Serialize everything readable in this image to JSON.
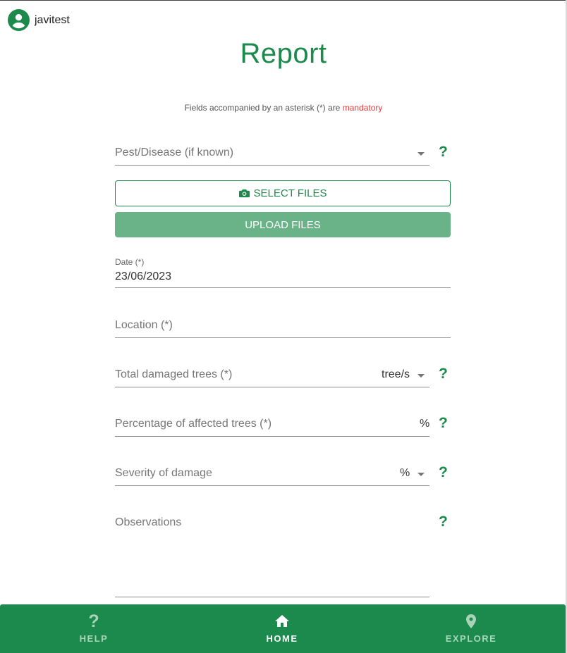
{
  "user": {
    "name": "javitest"
  },
  "page": {
    "title": "Report"
  },
  "note": {
    "prefix": "Fields accompanied by an asterisk (*) are ",
    "mandatory": "mandatory"
  },
  "form": {
    "pest": {
      "placeholder": "Pest/Disease (if known)"
    },
    "select_files": "SELECT FILES",
    "upload_files": "UPLOAD FILES",
    "date": {
      "label": "Date (*)",
      "value": "23/06/2023"
    },
    "location": {
      "placeholder": "Location (*)"
    },
    "damaged": {
      "placeholder": "Total damaged trees (*)",
      "unit": "tree/s"
    },
    "percentage": {
      "placeholder": "Percentage of affected trees (*)",
      "unit": "%"
    },
    "severity": {
      "placeholder": "Severity of damage",
      "unit": "%"
    },
    "observations": {
      "placeholder": "Observations"
    },
    "help_symbol": "?"
  },
  "nav": {
    "help": "HELP",
    "home": "HOME",
    "explore": "EXPLORE",
    "help_icon_glyph": "?"
  },
  "colors": {
    "primary": "#1b8a4c",
    "upload_button": "#6ab287",
    "mandatory": "#e53935"
  }
}
